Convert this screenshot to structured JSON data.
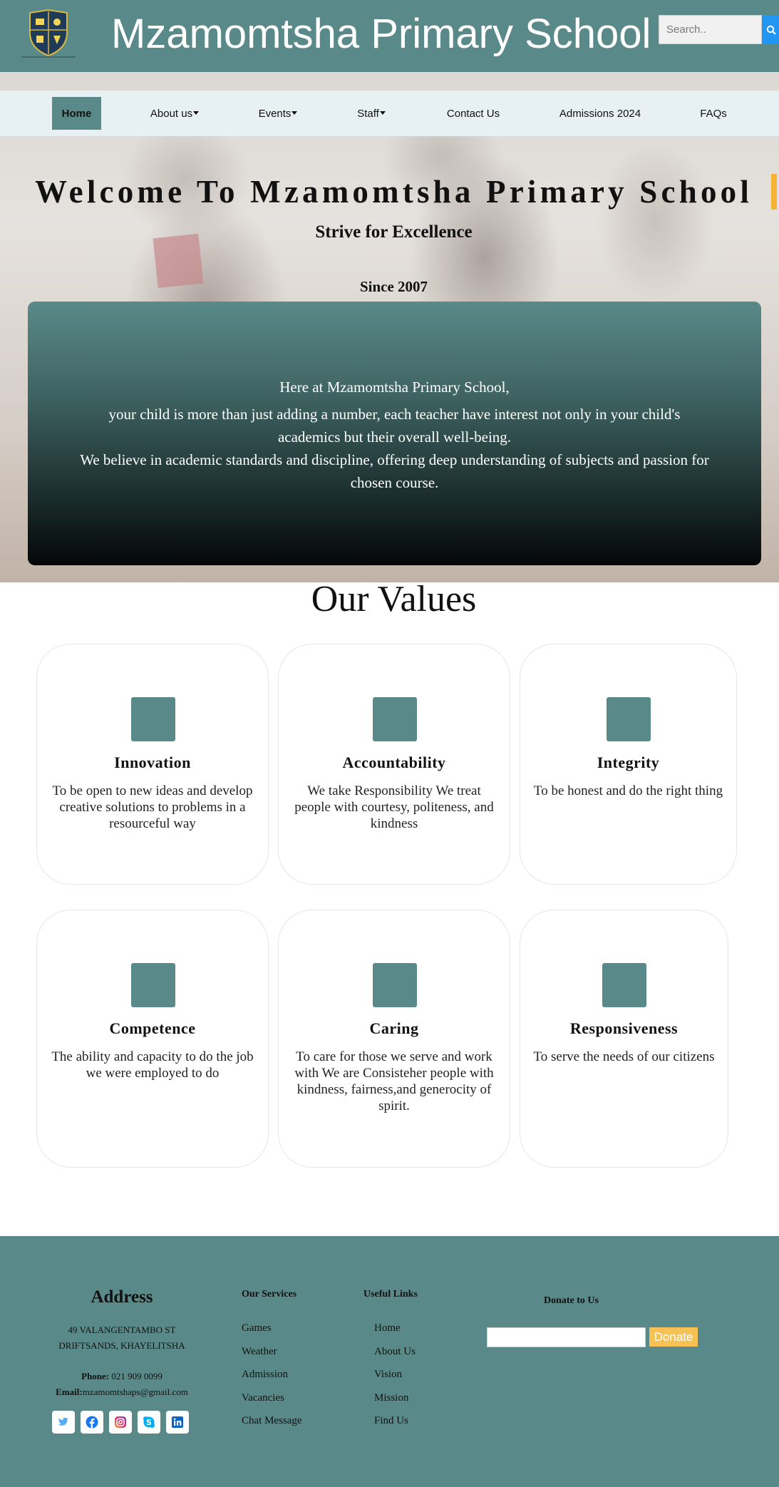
{
  "header": {
    "logo_icon": "school-crest-icon",
    "title": "Mzamomtsha Primary School",
    "search_placeholder": "Search..",
    "search_icon": "search-icon"
  },
  "nav": {
    "items": [
      {
        "label": "Home",
        "active": true
      },
      {
        "label": "About us",
        "dropdown": true
      },
      {
        "label": "Events",
        "dropdown": true
      },
      {
        "label": "Staff",
        "dropdown": true
      },
      {
        "label": "Contact Us"
      },
      {
        "label": "Admissions 2024"
      },
      {
        "label": "FAQs"
      }
    ]
  },
  "hero": {
    "welcome": "Welcome To Mzamomtsha Primary School",
    "tagline": "Strive for Excellence",
    "since": "Since 2007",
    "intro": [
      "Here at Mzamomtsha Primary School,",
      "your child is more than just adding a number, each teacher have interest not only in your child's",
      "academics but their overall well-being.",
      "We believe in academic standards and discipline, offering deep understanding of subjects and passion for",
      "chosen course."
    ]
  },
  "values": {
    "title": "Our Values",
    "cards": [
      {
        "title": "Innovation",
        "lines": [
          "To be open to new ideas and develop",
          "creative solutions to problems in a",
          "resourceful way"
        ]
      },
      {
        "title": "Accountability",
        "lines": [
          "We take Responsibility We treat",
          "people with courtesy, politeness, and",
          "kindness"
        ]
      },
      {
        "title": "Integrity",
        "lines": [
          "To be honest and do the right thing"
        ]
      },
      {
        "title": "Competence",
        "lines": [
          "The ability and capacity to do the job",
          "we were employed to do"
        ]
      },
      {
        "title": "Caring",
        "lines": [
          "To care for those we serve and work",
          "with We are Consisteher people with",
          "kindness, fairness,and generocity of",
          "spirit."
        ]
      },
      {
        "title": "Responsiveness",
        "lines": [
          "To serve the needs of our citizens"
        ]
      }
    ]
  },
  "footer": {
    "address_title": "Address",
    "address_lines": [
      "49 VALANGENTAMBO ST",
      "DRIFTSANDS, KHAYELITSHA"
    ],
    "phone_label": "Phone:",
    "phone_value": " 021 909 0099",
    "email_label": "Email:",
    "email_value": "mzamomtshaps@gmail.com",
    "social_icons": [
      "twitter-icon",
      "facebook-icon",
      "instagram-icon",
      "skype-icon",
      "linkedin-icon"
    ],
    "services_title": "Our Services",
    "services": [
      "Games",
      "Weather",
      "Admission",
      "Vacancies",
      "Chat Message"
    ],
    "links_title": "Useful Links",
    "links": [
      "Home",
      "About Us",
      "Vision",
      "Mission",
      "Find Us"
    ],
    "donate_title": "Donate to Us",
    "donate_button": "Donate"
  },
  "colors": {
    "primary": "#598a89",
    "accent": "#f7b334",
    "search_button": "#2196f3",
    "donate_button": "#f6c253"
  }
}
